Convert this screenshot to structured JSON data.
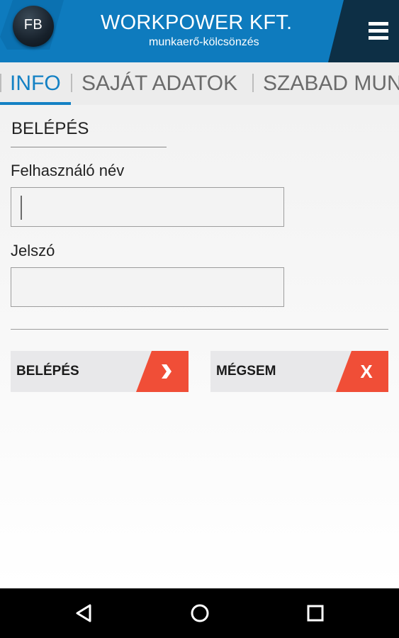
{
  "header": {
    "logo_text": "FB",
    "brand": "WORKPOWER KFT.",
    "tagline": "munkaerő-kölcsönzés",
    "menu_icon": "hamburger-menu-icon",
    "background_color": "#0e7bbe",
    "menu_background_color": "#0d2f45"
  },
  "tabs": [
    {
      "label": "INFO",
      "active": true
    },
    {
      "label": "SAJÁT ADATOK",
      "active": false
    },
    {
      "label": "SZABAD MUN",
      "active": false
    }
  ],
  "login": {
    "title": "BELÉPÉS",
    "username_label": "Felhasználó név",
    "username_value": "",
    "password_label": "Jelszó",
    "password_value": "",
    "submit_label": "BELÉPÉS",
    "submit_icon": "chevron-right-icon",
    "cancel_label": "MÉGSEM",
    "cancel_icon_text": "X",
    "accent_color": "#f04e37"
  },
  "system_nav": {
    "back_icon": "back-triangle-icon",
    "home_icon": "home-circle-icon",
    "recents_icon": "recents-square-icon"
  }
}
